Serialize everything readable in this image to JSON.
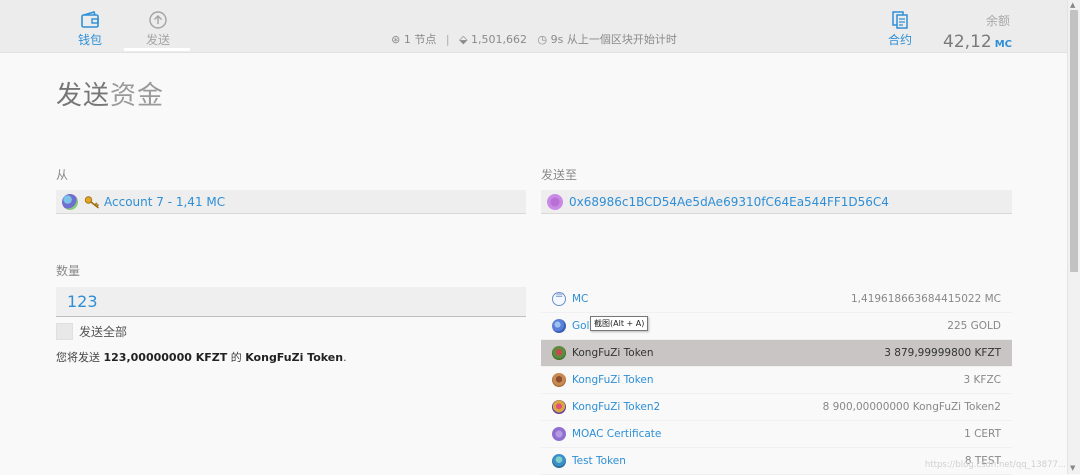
{
  "header": {
    "nav": {
      "wallet": "钱包",
      "send": "发送",
      "contracts": "合约"
    },
    "node_info": {
      "peers": "1 节点",
      "block": "1,501,662",
      "timer": "9s 从上一個区块开始计时"
    },
    "balance": {
      "label": "余额",
      "value": "42,12",
      "unit": "MC"
    }
  },
  "page": {
    "title_strong": "发送",
    "title_light": "资金"
  },
  "from": {
    "label": "从",
    "account": "Account 7 - 1,41 MC"
  },
  "to": {
    "label": "发送至",
    "address": "0x68986c1BCD54Ae5dAe69310fC64Ea544FF1D56C4"
  },
  "amount": {
    "label": "数量",
    "value": "123",
    "send_all_label": "发送全部",
    "summary_prefix": "您将发送",
    "summary_amount": "123,00000000 KFZT",
    "summary_middle": "的",
    "summary_token": "KongFuZi Token",
    "summary_suffix": "."
  },
  "tokens": [
    {
      "name": "MC",
      "amount": "1,419618663684415022 MC",
      "icon": "moac-icon"
    },
    {
      "name": "Gol",
      "amount": "225 GOLD",
      "icon": "gold-token-icon"
    },
    {
      "name": "KongFuZi Token",
      "amount": "3 879,99999800 KFZT",
      "icon": "kfzt-token-icon"
    },
    {
      "name": "KongFuZi Token",
      "amount": "3 KFZC",
      "icon": "kfzc-token-icon"
    },
    {
      "name": "KongFuZi Token2",
      "amount": "8 900,00000000 KongFuZi Token2",
      "icon": "kfz2-token-icon"
    },
    {
      "name": "MOAC Certificate",
      "amount": "1 CERT",
      "icon": "cert-token-icon"
    },
    {
      "name": "Test Token",
      "amount": "8 TEST",
      "icon": "test-token-icon"
    }
  ],
  "tooltip": "截图(Alt + A)",
  "watermark": "https://blog.csdn.net/qq_13877...",
  "colors": {
    "accent": "#2e8fd6",
    "selected_row": "#c9c5c5",
    "header_bg": "#ececec"
  }
}
